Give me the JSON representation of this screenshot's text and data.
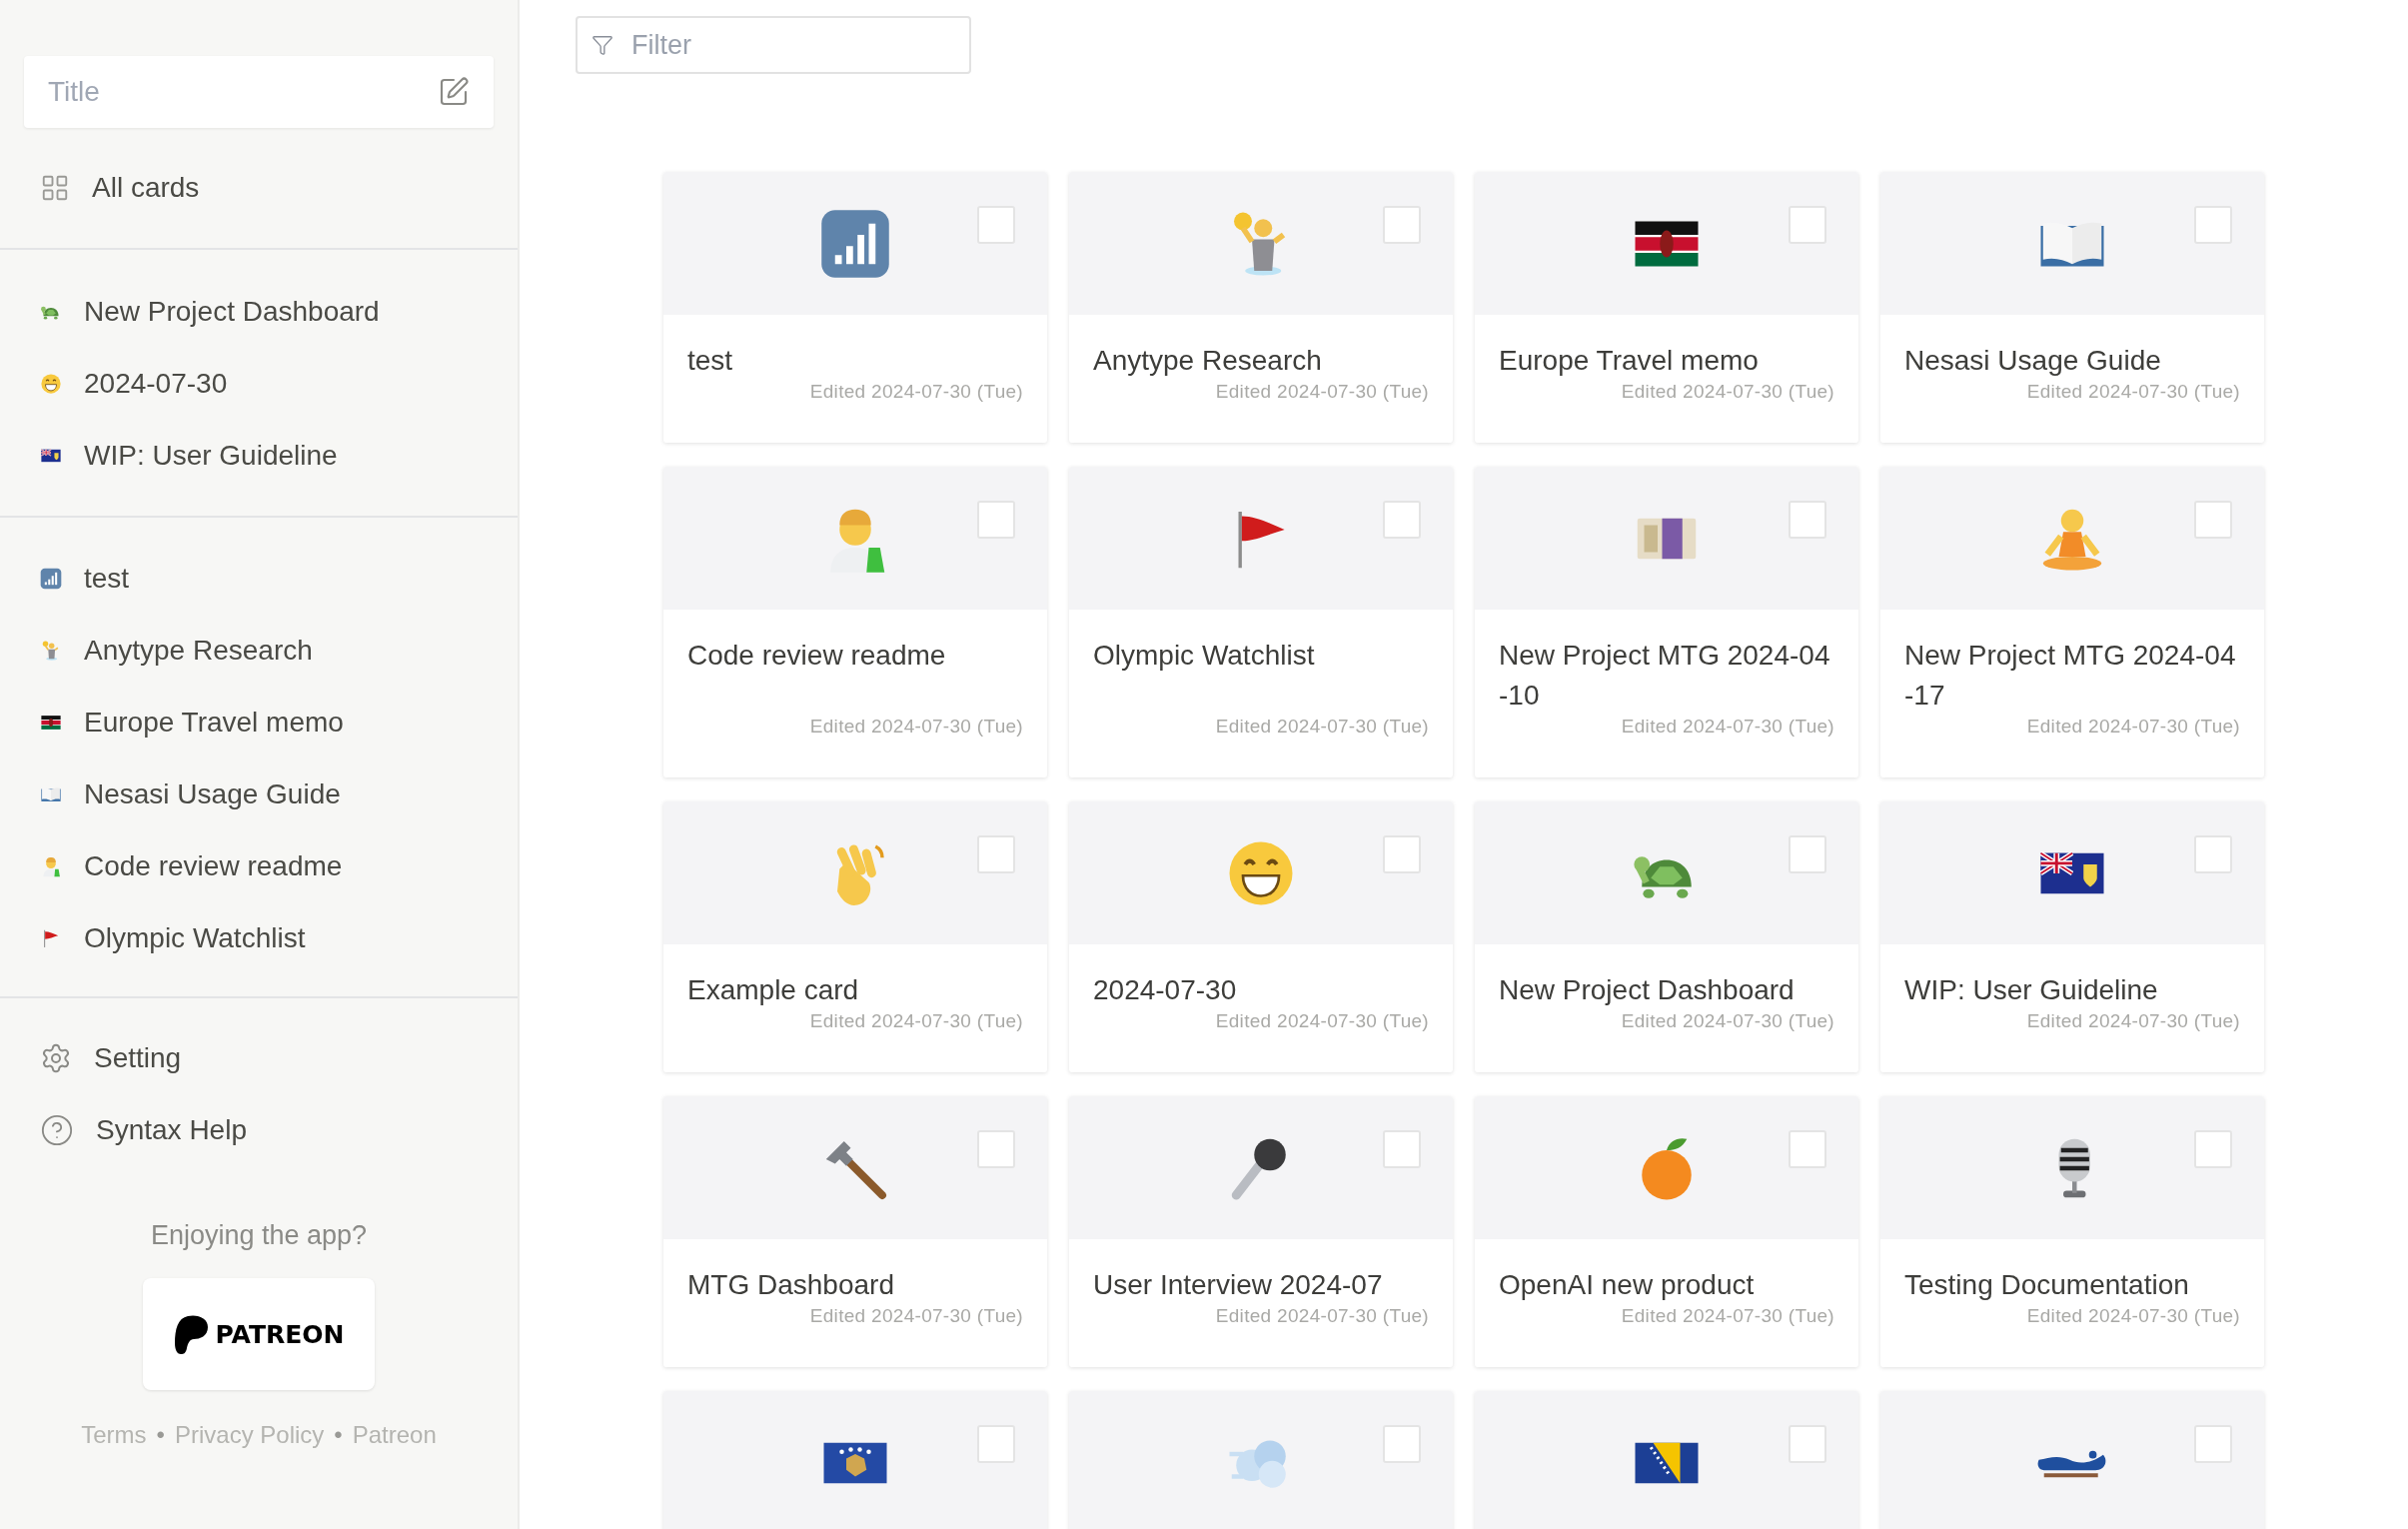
{
  "sidebar": {
    "title_field": {
      "placeholder": "Title"
    },
    "all_cards": {
      "label": "All cards"
    },
    "pinned": [
      {
        "title": "New Project Dashboard"
      },
      {
        "title": "2024-07-30"
      },
      {
        "title": "WIP: User Guideline"
      }
    ],
    "recent": [
      {
        "title": "test"
      },
      {
        "title": "Anytype Research"
      },
      {
        "title": "Europe Travel memo"
      },
      {
        "title": "Nesasi Usage Guide"
      },
      {
        "title": "Code review readme"
      },
      {
        "title": "Olympic Watchlist"
      }
    ],
    "menu": [
      {
        "kind": "settings",
        "label": "Setting"
      },
      {
        "kind": "help",
        "label": "Syntax Help"
      }
    ],
    "support": {
      "prompt": "Enjoying the app?",
      "button": "PATREON"
    },
    "footer": [
      {
        "kind": "link",
        "text": "Terms"
      },
      {
        "kind": "separator",
        "text": "•"
      },
      {
        "kind": "link",
        "text": "Privacy Policy"
      },
      {
        "kind": "separator",
        "text": "•"
      },
      {
        "kind": "link",
        "text": "Patreon"
      }
    ]
  },
  "filter": {
    "placeholder": "Filter"
  },
  "cards": [
    {
      "title": "test",
      "edited": "Edited 2024-07-30 (Tue)",
      "checked": false
    },
    {
      "title": "Anytype Research",
      "edited": "Edited 2024-07-30 (Tue)",
      "checked": false
    },
    {
      "title": "Europe Travel memo",
      "edited": "Edited 2024-07-30 (Tue)",
      "checked": false
    },
    {
      "title": "Nesasi Usage Guide",
      "edited": "Edited 2024-07-30 (Tue)",
      "checked": false
    },
    {
      "title": "Code review readme",
      "edited": "Edited 2024-07-30 (Tue)",
      "checked": false
    },
    {
      "title": "Olympic Watchlist",
      "edited": "Edited 2024-07-30 (Tue)",
      "checked": false
    },
    {
      "title": "New Project MTG 2024-04-10",
      "edited": "Edited 2024-07-30 (Tue)",
      "checked": false
    },
    {
      "title": "New Project MTG 2024-04-17",
      "edited": "Edited 2024-07-30 (Tue)",
      "checked": false
    },
    {
      "title": "Example card",
      "edited": "Edited 2024-07-30 (Tue)",
      "checked": false
    },
    {
      "title": "2024-07-30",
      "edited": "Edited 2024-07-30 (Tue)",
      "checked": false
    },
    {
      "title": "New Project Dashboard",
      "edited": "Edited 2024-07-30 (Tue)",
      "checked": false
    },
    {
      "title": "WIP: User Guideline",
      "edited": "Edited 2024-07-30 (Tue)",
      "checked": false
    },
    {
      "title": "MTG Dashboard",
      "edited": "Edited 2024-07-30 (Tue)",
      "checked": false
    },
    {
      "title": "User Interview 2024-07",
      "edited": "Edited 2024-07-30 (Tue)",
      "checked": false
    },
    {
      "title": "OpenAI new product",
      "edited": "Edited 2024-07-30 (Tue)",
      "checked": false
    },
    {
      "title": "Testing Documentation",
      "edited": "Edited 2024-07-30 (Tue)",
      "checked": false
    },
    {
      "checked": false
    },
    {
      "checked": false
    },
    {
      "checked": false
    },
    {
      "checked": false
    }
  ]
}
